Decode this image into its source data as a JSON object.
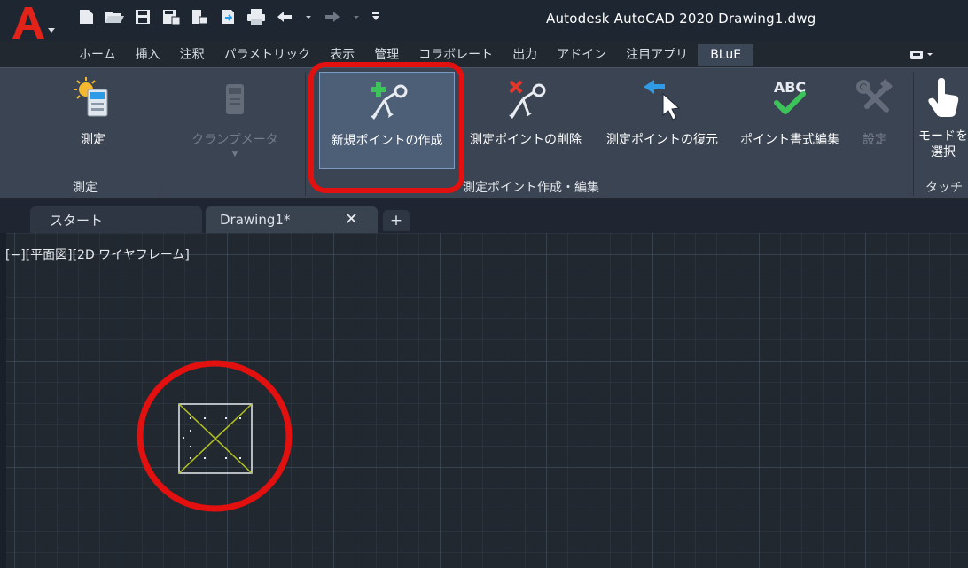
{
  "window": {
    "title": "Autodesk AutoCAD 2020    Drawing1.dwg"
  },
  "quick_access": {
    "icons": [
      "new-icon",
      "open-icon",
      "save-icon",
      "save-as-icon",
      "plot-preview-icon",
      "share-icon",
      "print-icon",
      "undo-icon",
      "redo-icon",
      "customize-icon"
    ]
  },
  "ribbon_tabs": [
    {
      "label": "ホーム"
    },
    {
      "label": "挿入"
    },
    {
      "label": "注釈"
    },
    {
      "label": "パラメトリック"
    },
    {
      "label": "表示"
    },
    {
      "label": "管理"
    },
    {
      "label": "コラボレート"
    },
    {
      "label": "出力"
    },
    {
      "label": "アドイン"
    },
    {
      "label": "注目アプリ"
    },
    {
      "label": "BLuE"
    }
  ],
  "ribbon": {
    "measure_panel": {
      "button_label": "測定",
      "title": "測定"
    },
    "clamp_meter": {
      "label": "クランプメータ"
    },
    "point_panel": {
      "new_point": "新規ポイントの作成",
      "delete_point": "測定ポイントの削除",
      "restore_point": "測定ポイントの復元",
      "format_edit": "ポイント書式編集",
      "settings": "設定",
      "title": "測定ポイント作成・編集",
      "abc_text": "ABC"
    },
    "touch_panel": {
      "mode_label_line1": "モードを",
      "mode_label_line2": "選択",
      "title": "タッチ"
    }
  },
  "doc_tabs": {
    "start": "スタート",
    "drawing": "Drawing1*",
    "close_glyph": "✕",
    "add_glyph": "+"
  },
  "viewport": {
    "label": "[−][平面図][2D ワイヤフレーム]"
  },
  "colors": {
    "highlight_ring": "#e2100f",
    "accent_green": "#3cc45a",
    "accent_red": "#e2372b",
    "accent_blue": "#2e9be6",
    "marker_cross": "#b3c21c"
  }
}
